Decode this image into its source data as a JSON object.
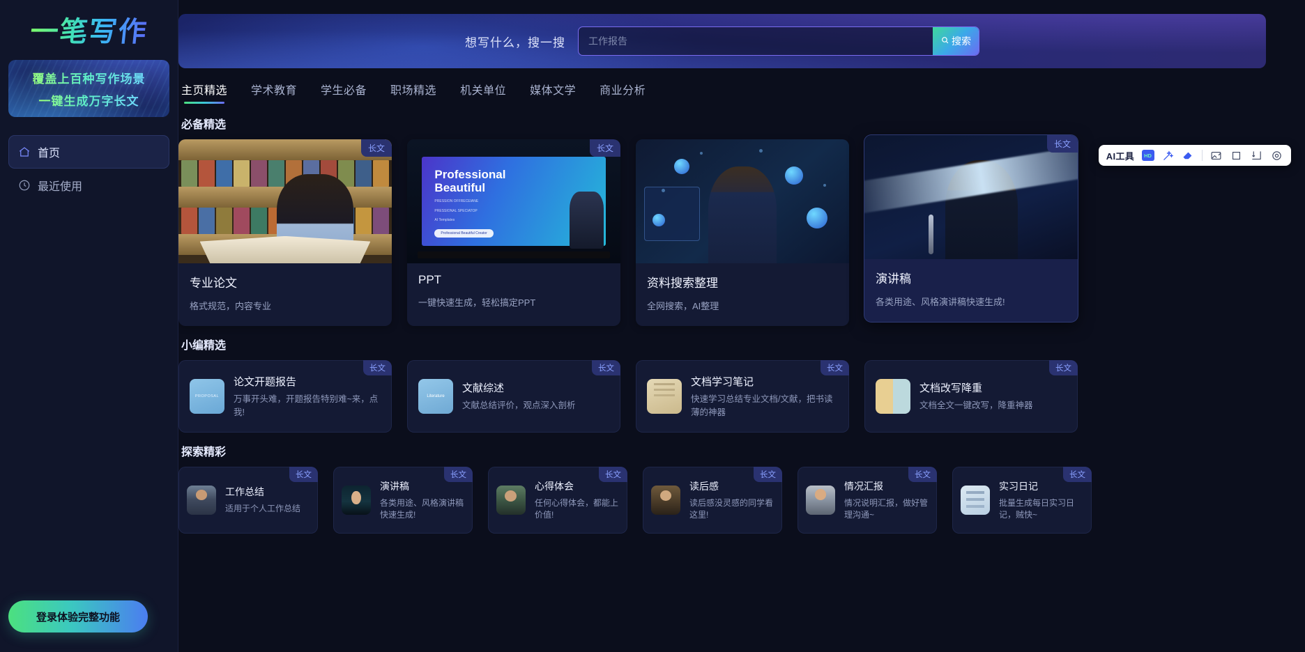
{
  "brand": {
    "logo_text": "一笔写作"
  },
  "promo": {
    "line1": "覆盖上百种写作场景",
    "line2": "一键生成万字长文"
  },
  "sidebar": {
    "items": [
      {
        "label": "首页",
        "icon": "home-icon",
        "active": true
      },
      {
        "label": "最近使用",
        "icon": "clock-icon",
        "active": false
      }
    ],
    "login_button": "登录体验完整功能"
  },
  "search": {
    "label": "想写什么，搜一搜",
    "placeholder": "工作报告",
    "value": "",
    "button": "搜索",
    "button_icon": "search-icon"
  },
  "tabs": [
    {
      "label": "主页精选",
      "active": true
    },
    {
      "label": "学术教育",
      "active": false
    },
    {
      "label": "学生必备",
      "active": false
    },
    {
      "label": "职场精选",
      "active": false
    },
    {
      "label": "机关单位",
      "active": false
    },
    {
      "label": "媒体文学",
      "active": false
    },
    {
      "label": "商业分析",
      "active": false
    }
  ],
  "toolbar": {
    "label": "AI工具",
    "hd_badge": "HD",
    "icons": [
      "hd-image-icon",
      "magic-wand-icon",
      "eraser-icon",
      "edit-image-icon",
      "crop-icon",
      "download-icon",
      "settings-icon"
    ]
  },
  "sections": [
    {
      "title": "必备精选",
      "type": "feature",
      "cards": [
        {
          "title": "专业论文",
          "desc": "格式规范，内容专业",
          "badge": "长文",
          "art": "library",
          "highlight": false
        },
        {
          "title": "PPT",
          "desc": "一键快速生成，轻松搞定PPT",
          "badge": "长文",
          "art": "ppt",
          "highlight": false,
          "slide": {
            "heading1": "Professional",
            "heading2": "Beautiful",
            "sub1": "PRESSION OFFRECEIANE",
            "sub2": "PRESSIONAL SPECIATOP",
            "sub3": "AI Templates",
            "pill": "Professional Beautiful Creator"
          }
        },
        {
          "title": "资料搜索整理",
          "desc": "全网搜索，AI整理",
          "badge": "",
          "art": "data",
          "highlight": false
        },
        {
          "title": "演讲稿",
          "desc": "各类用途、风格演讲稿快速生成!",
          "badge": "长文",
          "art": "speech",
          "highlight": true
        }
      ]
    },
    {
      "title": "小编精选",
      "type": "compact",
      "cards": [
        {
          "title": "论文开题报告",
          "desc": "万事开头难，开题报告特别难~来，点我!",
          "badge": "长文",
          "thumb": "proposal",
          "thumb_text": "PROPOSAL"
        },
        {
          "title": "文献综述",
          "desc": "文献总结评价，观点深入剖析",
          "badge": "长文",
          "thumb": "literature",
          "thumb_text": "Literature"
        },
        {
          "title": "文档学习笔记",
          "desc": "快速学习总结专业文档/文献，把书读薄的神器",
          "badge": "长文",
          "thumb": "note",
          "thumb_text": ""
        },
        {
          "title": "文档改写降重",
          "desc": "文档全文一键改写，降重神器",
          "badge": "长文",
          "thumb": "rewrite",
          "thumb_text": ""
        }
      ]
    },
    {
      "title": "探索精彩",
      "type": "compact-small",
      "cards": [
        {
          "title": "工作总结",
          "desc": "适用于个人工作总结",
          "badge": "长文",
          "thumb": "person1"
        },
        {
          "title": "演讲稿",
          "desc": "各类用途、风格演讲稿快速生成!",
          "badge": "长文",
          "thumb": "stage"
        },
        {
          "title": "心得体会",
          "desc": "任何心得体会，都能上价值!",
          "badge": "长文",
          "thumb": "person2"
        },
        {
          "title": "读后感",
          "desc": "读后感没灵感的同学看这里!",
          "badge": "长文",
          "thumb": "read"
        },
        {
          "title": "情况汇报",
          "desc": "情况说明汇报，做好管理沟通~",
          "badge": "长文",
          "thumb": "suit"
        },
        {
          "title": "实习日记",
          "desc": "批量生成每日实习日记，贼快~",
          "badge": "长文",
          "thumb": "diary"
        }
      ]
    }
  ],
  "colors": {
    "accent_green": "#4ce07f",
    "accent_blue": "#3bb6f5",
    "accent_purple": "#6b6bf2",
    "badge_bg": "#2a3270",
    "badge_text": "#8aa0ff"
  }
}
